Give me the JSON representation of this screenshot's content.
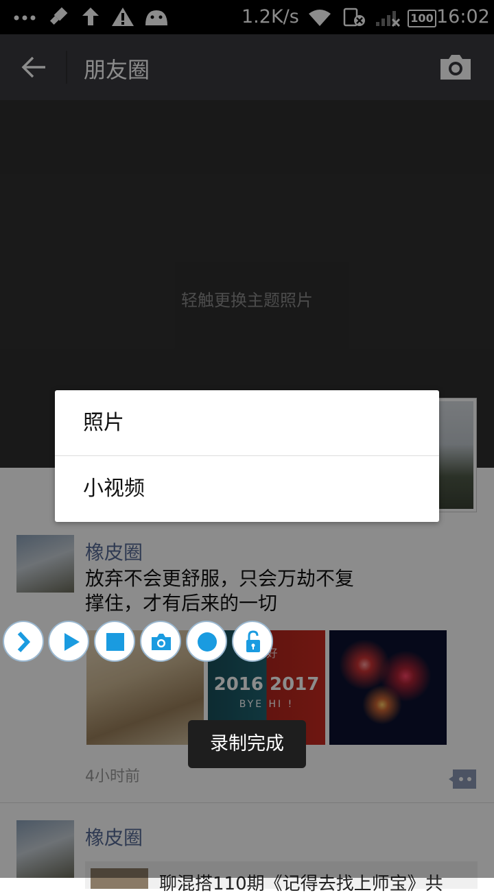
{
  "status_bar": {
    "net_speed": "1.2K/s",
    "battery": "100",
    "time": "16:02"
  },
  "title_bar": {
    "title": "朋友圈"
  },
  "cover": {
    "hint": "轻触更换主题照片"
  },
  "post1": {
    "author": "橡皮圈",
    "text_line1": "放弃不会更舒服，只会万劫不复",
    "text_line2": "撑住，才有后来的一切",
    "image2_lines": [
      "你好",
      "2016 2017",
      "BYE HI !"
    ],
    "time": "4小时前"
  },
  "post2": {
    "author": "橡皮圈",
    "link_text": "聊混搭110期《记得去找上师宝》共"
  },
  "popup_menu": {
    "items": [
      "照片",
      "小视频"
    ]
  },
  "toast": {
    "text": "录制完成"
  },
  "colors": {
    "title_bar_bg": "#393a3f",
    "name_link": "#576b95",
    "recorder_accent": "#1a9be0"
  }
}
